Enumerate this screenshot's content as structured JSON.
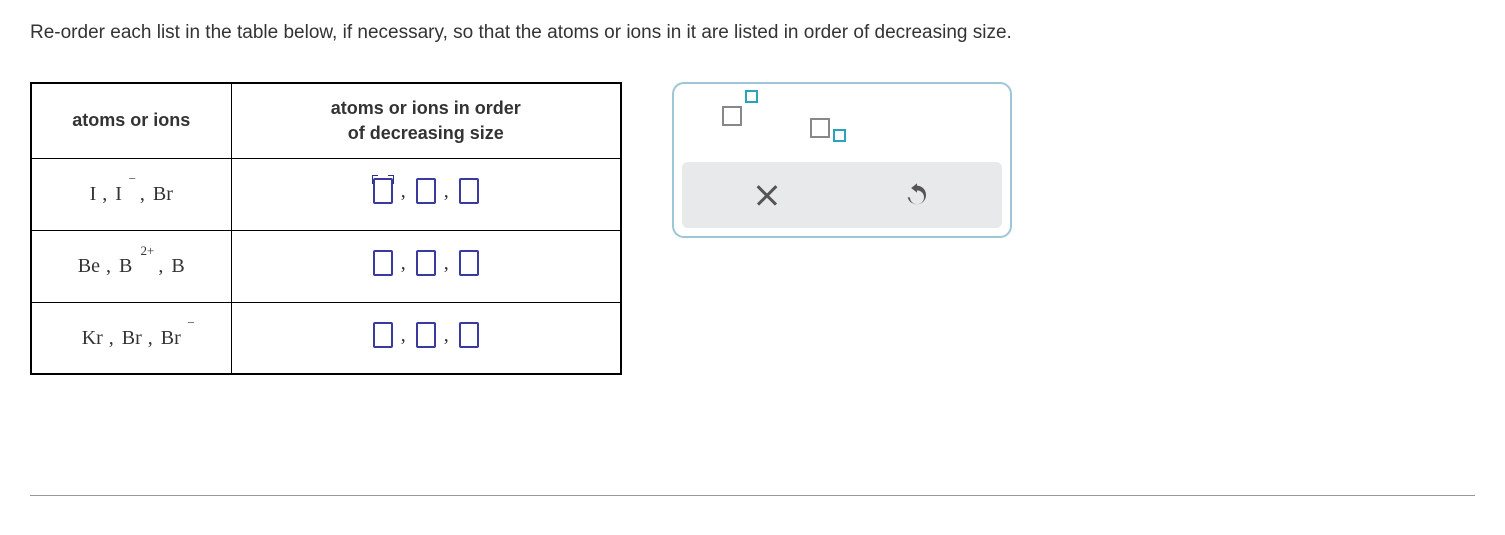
{
  "instruction": "Re-order each list in the table below, if necessary, so that the atoms or ions in it are listed in order of decreasing size.",
  "table": {
    "headers": {
      "col_a": "atoms or ions",
      "col_b": "atoms or ions in order\nof decreasing size"
    },
    "rows": [
      {
        "species": [
          {
            "sym": "I",
            "sup": ""
          },
          {
            "sym": "I",
            "sup": "−"
          },
          {
            "sym": "Br",
            "sup": ""
          }
        ]
      },
      {
        "species": [
          {
            "sym": "Be",
            "sup": ""
          },
          {
            "sym": "B",
            "sup": "2+"
          },
          {
            "sym": "B",
            "sup": ""
          }
        ]
      },
      {
        "species": [
          {
            "sym": "Kr",
            "sup": ""
          },
          {
            "sym": "Br",
            "sup": ""
          },
          {
            "sym": "Br",
            "sup": "−"
          }
        ]
      }
    ]
  },
  "separator": ",",
  "palette": {
    "superscript": "superscript",
    "subscript": "subscript",
    "clear": "clear",
    "undo": "undo"
  }
}
